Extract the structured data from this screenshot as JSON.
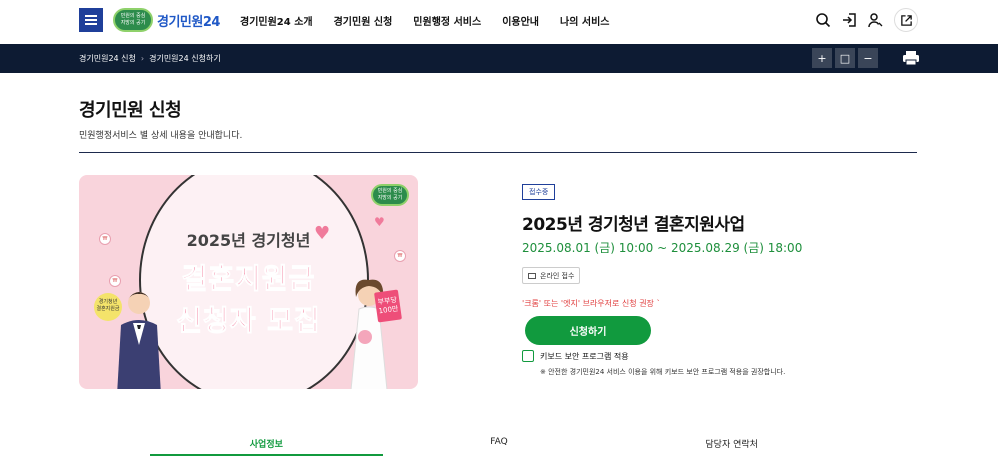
{
  "header": {
    "logo_badge": "민원의 중심\n지방의 공기",
    "logo_name": "경기민원24",
    "nav": [
      "경기민원24 소개",
      "경기민원 신청",
      "민원행정 서비스",
      "이용안내",
      "나의 서비스"
    ],
    "icons": [
      "search-icon",
      "login-icon",
      "user-icon",
      "external-link-icon"
    ]
  },
  "breadcrumb": [
    "경기민원24 신청",
    "경기민원24 신청하기"
  ],
  "zoom_controls": [
    "+",
    "□",
    "−"
  ],
  "page": {
    "title": "경기민원 신청",
    "subtitle": "민원행정서비스 별 상세 내용을 안내합니다."
  },
  "poster": {
    "line1": "2025년 경기청년",
    "line2": "결혼지원금",
    "line3": "신청자 모집"
  },
  "detail": {
    "status": "접수중",
    "title": "2025년 경기청년 결혼지원사업",
    "period": "2025.08.01 (금) 10:00 ~ 2025.08.29 (금) 18:00",
    "online_label": "온라인 접수",
    "notice": "'크롬' 또는 '엣지' 브라우저로 신청 권장 `",
    "apply_label": "신청하기",
    "keyboard_label": "키보드 보안 프로그램 적용",
    "keyboard_note": "※ 안전한 경기민원24 서비스 이용을 위해 키보드 보안 프로그램 적용을 권장합니다."
  },
  "tabs": [
    "사업정보",
    "FAQ",
    "담당자 연락처"
  ],
  "colors": {
    "brand_navy": "#1f3f9a",
    "accent_green": "#119a3e",
    "dark_bar": "#0d1b33",
    "alert_red": "#e03c3c"
  }
}
